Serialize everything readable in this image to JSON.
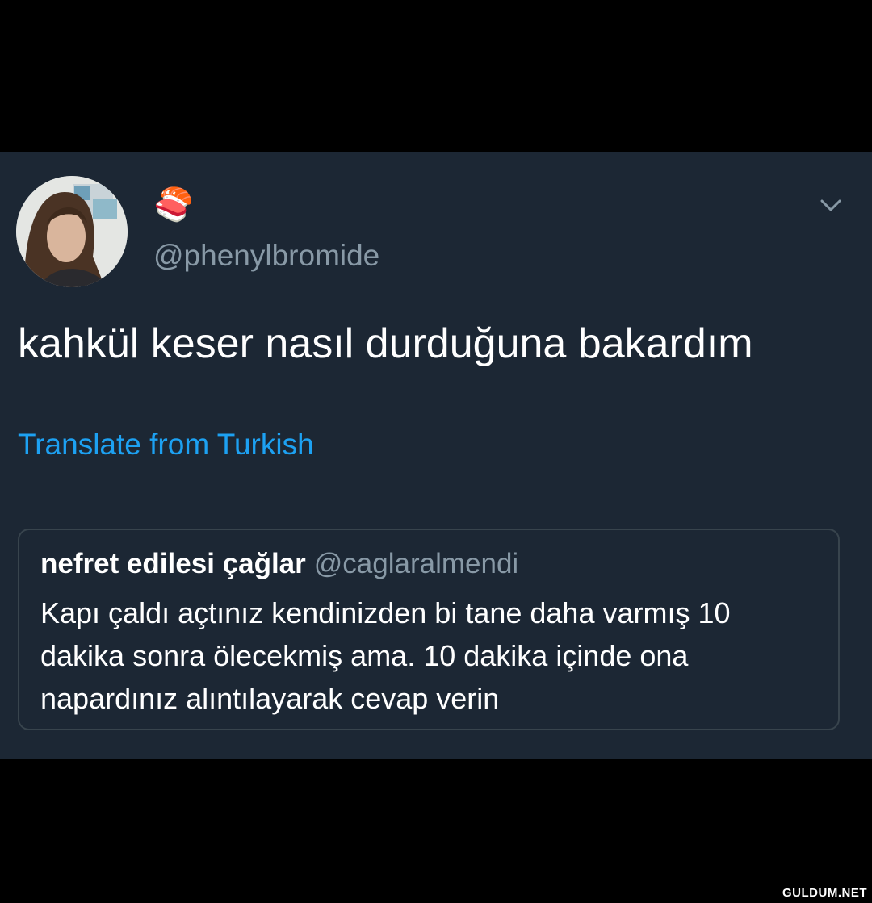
{
  "tweet": {
    "display_name": "🍣",
    "handle": "@phenylbromide",
    "text": "kahkül keser nasıl durduğuna bakardım",
    "translate_label": "Translate from Turkish"
  },
  "quoted_tweet": {
    "name": "nefret edilesi çağlar",
    "handle": "@caglaralmendi",
    "text": "Kapı çaldı açtınız kendinizden bi tane daha varmış 10 dakika sonra ölecekmiş ama. 10 dakika içinde ona napardınız alıntılayarak cevap verin"
  },
  "icons": {
    "menu": "chevron-down-icon",
    "avatar": "avatar"
  },
  "colors": {
    "background": "#1c2734",
    "link": "#1da1f2",
    "muted": "#8899a6",
    "border": "#38444d"
  },
  "watermark": "GULDUM.NET"
}
